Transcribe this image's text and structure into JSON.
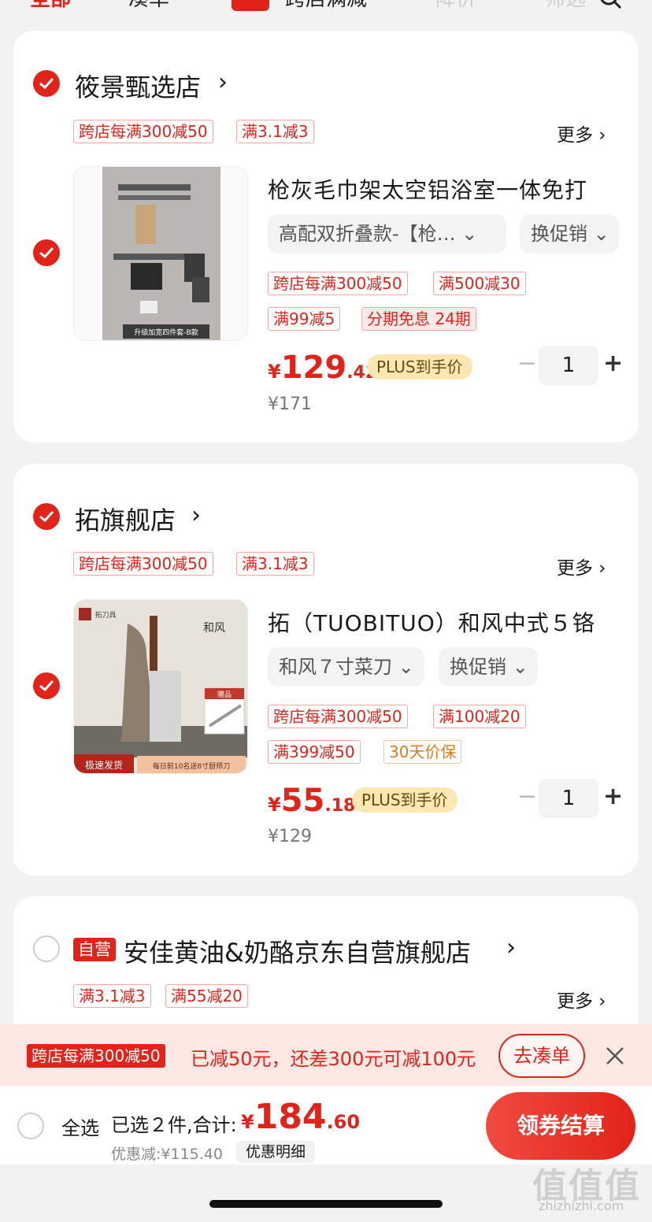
{
  "tabs": [
    {
      "label": "全部"
    },
    {
      "label": "凑单"
    },
    {
      "label": "跨店满减"
    },
    {
      "label": "降价"
    },
    {
      "label": "筛选"
    }
  ],
  "tab_badge_label": "促",
  "shops": [
    {
      "name": "筱景甄选店",
      "tags": [
        "跨店每满300减50",
        "满3.1减3"
      ],
      "more": "更多 ›",
      "item": {
        "title": "枪灰毛巾架太空铝浴室一体免打",
        "spec": "高配双折叠款-【枪… ⌄",
        "promo_select": "换促销 ⌄",
        "tags": [
          "跨店每满300减50",
          "满500减30",
          "满99减5",
          "分期免息 24期"
        ],
        "price_currency": "¥",
        "price_int": "129",
        "price_dec": ".42",
        "plus_label": "PLUS到手价",
        "orig_price": "¥171",
        "qty": "1",
        "thumb_caption": "升级加宽四件套-B款"
      }
    },
    {
      "name": "拓旗舰店",
      "tags": [
        "跨店每满300减50",
        "满3.1减3"
      ],
      "more": "更多 ›",
      "item": {
        "title": "拓（TUOBITUO）和风中式５铬",
        "spec": "和风７寸菜刀 ⌄",
        "promo_select": "换促销 ⌄",
        "tags": [
          "跨店每满300减50",
          "满100减20",
          "满399减50",
          "30天价保"
        ],
        "price_currency": "¥",
        "price_int": "55",
        "price_dec": ".18",
        "plus_label": "PLUS到手价",
        "orig_price": "¥129",
        "qty": "1",
        "thumb_left_label": "极速发货",
        "thumb_right_label": "每日前10名送8寸厨师刀",
        "thumb_gift_label": "赠品",
        "thumb_logo": "拓刀具",
        "thumb_calligraphy": "和风"
      }
    },
    {
      "self_badge": "自营",
      "name": "安佳黄油&奶酪京东自营旗舰店",
      "tags": [
        "满3.1减3",
        "满55减20"
      ],
      "more": "更多 ›"
    }
  ],
  "promo_bar": {
    "tag": "跨店每满300减50",
    "text": "已减50元，还差300元可减100元",
    "button": "去凑单"
  },
  "bottom": {
    "select_all": "全选",
    "selected_text": "已选２件,合计:",
    "total_currency": "¥",
    "total_int": "184",
    "total_dec": ".60",
    "discount": "优惠减:¥115.40",
    "detail": "优惠明细",
    "checkout": "领券结算"
  },
  "watermark": {
    "text": "值值值",
    "url": "zhizhizhi.com"
  },
  "colors": {
    "accent": "#e2231a",
    "plus_badge": "#fbe7b2",
    "background": "#f2f2f2"
  }
}
